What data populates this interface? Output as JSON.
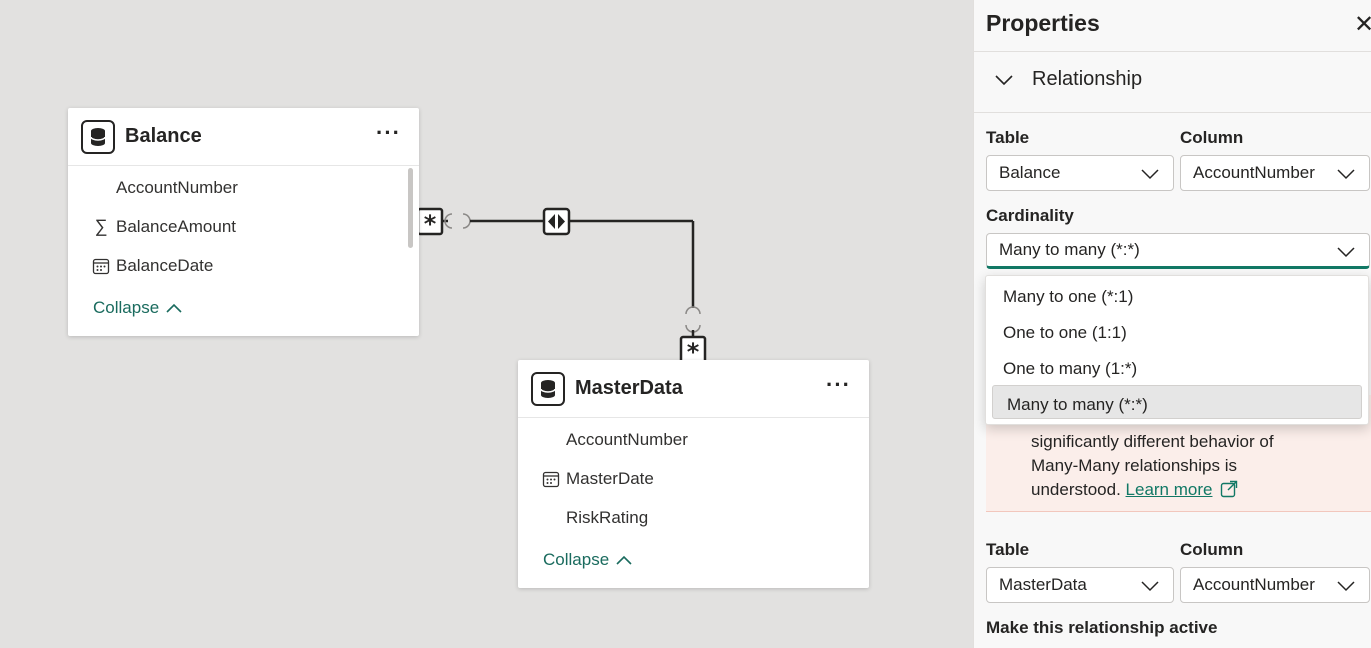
{
  "canvas": {
    "tables": [
      {
        "name": "Balance",
        "fields": [
          {
            "label": "AccountNumber",
            "icon": ""
          },
          {
            "label": "BalanceAmount",
            "icon": "sigma-icon"
          },
          {
            "label": "BalanceDate",
            "icon": "calendar-icon"
          }
        ],
        "collapse_label": "Collapse"
      },
      {
        "name": "MasterData",
        "fields": [
          {
            "label": "AccountNumber",
            "icon": ""
          },
          {
            "label": "MasterDate",
            "icon": "calendar-icon"
          },
          {
            "label": "RiskRating",
            "icon": ""
          }
        ],
        "collapse_label": "Collapse"
      }
    ],
    "relationship": {
      "from_marker": "*",
      "to_marker": "*",
      "filter_direction": "both"
    }
  },
  "panel": {
    "title": "Properties",
    "section": "Relationship",
    "first": {
      "table_label": "Table",
      "column_label": "Column",
      "table_value": "Balance",
      "column_value": "AccountNumber"
    },
    "cardinality": {
      "label": "Cardinality",
      "value": "Many to many (*:*)",
      "options": [
        "Many to one (*:1)",
        "One to one (1:1)",
        "One to many (1:*)",
        "Many to many (*:*)"
      ]
    },
    "warning": {
      "line1": "significantly different behavior of",
      "line2": "Many-Many relationships is",
      "line3": "understood.",
      "link": "Learn more"
    },
    "second": {
      "table_label": "Table",
      "column_label": "Column",
      "table_value": "MasterData",
      "column_value": "AccountNumber"
    },
    "active_label": "Make this relationship active"
  },
  "colors": {
    "accent": "#117865",
    "warning_bg": "#fbeeea",
    "canvas": "#e2e1e0"
  }
}
